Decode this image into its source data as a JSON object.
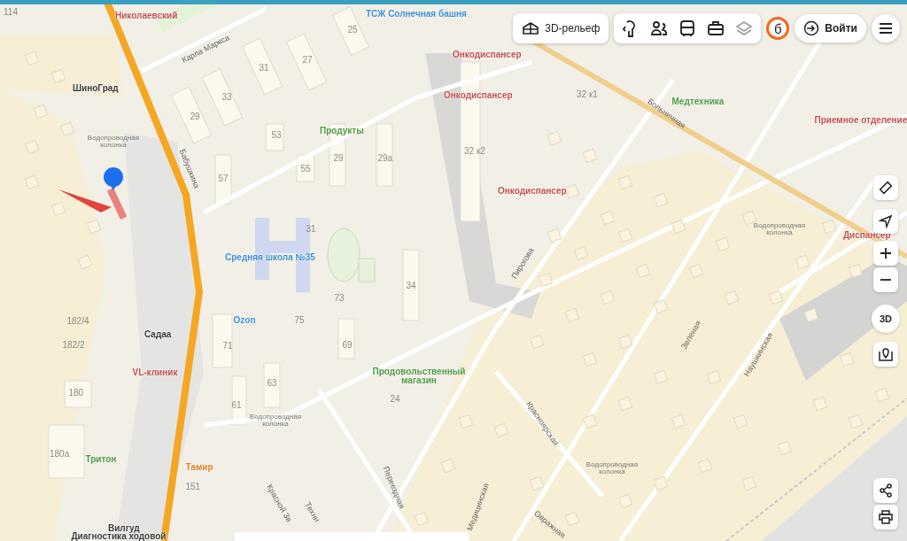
{
  "toolbar": {
    "relief_button": "3D-рельеф",
    "layer_buttons": [
      {
        "kind": "person",
        "disabled": false
      },
      {
        "kind": "people",
        "disabled": false
      },
      {
        "kind": "bus",
        "disabled": false
      },
      {
        "kind": "briefcase",
        "disabled": false
      },
      {
        "kind": "layers",
        "disabled": true
      }
    ],
    "badge": "б",
    "login_button": "Войти"
  },
  "controls": {
    "compass_label": "3D"
  },
  "labels": [
    {
      "text": "114",
      "kind": "house"
    },
    {
      "text": "Николаевский",
      "kind": "poi-red"
    },
    {
      "text": "ТСЖ Солнечная башня",
      "kind": "poi-blue"
    },
    {
      "text": "Карла Маркса",
      "kind": "street"
    },
    {
      "text": "ШиноГрад",
      "kind": "poi-dark"
    },
    {
      "text": "Водопроводная колонка",
      "kind": "note"
    },
    {
      "text": "Бабушкина",
      "kind": "street"
    },
    {
      "text": "25",
      "kind": "house"
    },
    {
      "text": "27",
      "kind": "house"
    },
    {
      "text": "31",
      "kind": "house"
    },
    {
      "text": "33",
      "kind": "house"
    },
    {
      "text": "29",
      "kind": "house"
    },
    {
      "text": "53",
      "kind": "house"
    },
    {
      "text": "55",
      "kind": "house"
    },
    {
      "text": "57",
      "kind": "house"
    },
    {
      "text": "Продукты",
      "kind": "poi-green"
    },
    {
      "text": "29",
      "kind": "house"
    },
    {
      "text": "29а",
      "kind": "house"
    },
    {
      "text": "Онкодиспансер",
      "kind": "poi-red"
    },
    {
      "text": "Онкодиспансер",
      "kind": "poi-red"
    },
    {
      "text": "32 к1",
      "kind": "house"
    },
    {
      "text": "32 к2",
      "kind": "house"
    },
    {
      "text": "Онкодиспансер",
      "kind": "poi-red"
    },
    {
      "text": "Больничная",
      "kind": "street"
    },
    {
      "text": "Медтехника",
      "kind": "poi-green"
    },
    {
      "text": "Приемное отделение",
      "kind": "poi-red"
    },
    {
      "text": "Водопроводная колонка",
      "kind": "note"
    },
    {
      "text": "Диспансер",
      "kind": "poi-red"
    },
    {
      "text": "31",
      "kind": "house"
    },
    {
      "text": "Средняя школа №35",
      "kind": "poi-blue"
    },
    {
      "text": "Пирогова",
      "kind": "street"
    },
    {
      "text": "34",
      "kind": "house"
    },
    {
      "text": "73",
      "kind": "house"
    },
    {
      "text": "182/4",
      "kind": "house"
    },
    {
      "text": "Ozon",
      "kind": "poi-blue"
    },
    {
      "text": "75",
      "kind": "house"
    },
    {
      "text": "Садаа",
      "kind": "poi-dark"
    },
    {
      "text": "182/2",
      "kind": "house"
    },
    {
      "text": "71",
      "kind": "house"
    },
    {
      "text": "69",
      "kind": "house"
    },
    {
      "text": "VL-клиник",
      "kind": "poi-red"
    },
    {
      "text": "Продовольственный магазин",
      "kind": "poi-green"
    },
    {
      "text": "180",
      "kind": "house"
    },
    {
      "text": "63",
      "kind": "house"
    },
    {
      "text": "24",
      "kind": "house"
    },
    {
      "text": "61",
      "kind": "house"
    },
    {
      "text": "Водопроводная колонка",
      "kind": "note"
    },
    {
      "text": "Красноярская",
      "kind": "street"
    },
    {
      "text": "Зеленая",
      "kind": "street"
    },
    {
      "text": "Наушкинская",
      "kind": "street"
    },
    {
      "text": "180а",
      "kind": "house"
    },
    {
      "text": "Тритон",
      "kind": "poi-green"
    },
    {
      "text": "Тамир",
      "kind": "poi-orange"
    },
    {
      "text": "Водопроводная колонка",
      "kind": "note"
    },
    {
      "text": "Переездная",
      "kind": "street"
    },
    {
      "text": "151",
      "kind": "house"
    },
    {
      "text": "Красной Зв",
      "kind": "street"
    },
    {
      "text": "Техни",
      "kind": "street"
    },
    {
      "text": "Медицинская",
      "kind": "street"
    },
    {
      "text": "Овражная",
      "kind": "street"
    },
    {
      "text": "Вилгуд",
      "kind": "poi-dark"
    },
    {
      "text": "Диагностика ходовой",
      "kind": "poi-dark"
    }
  ]
}
